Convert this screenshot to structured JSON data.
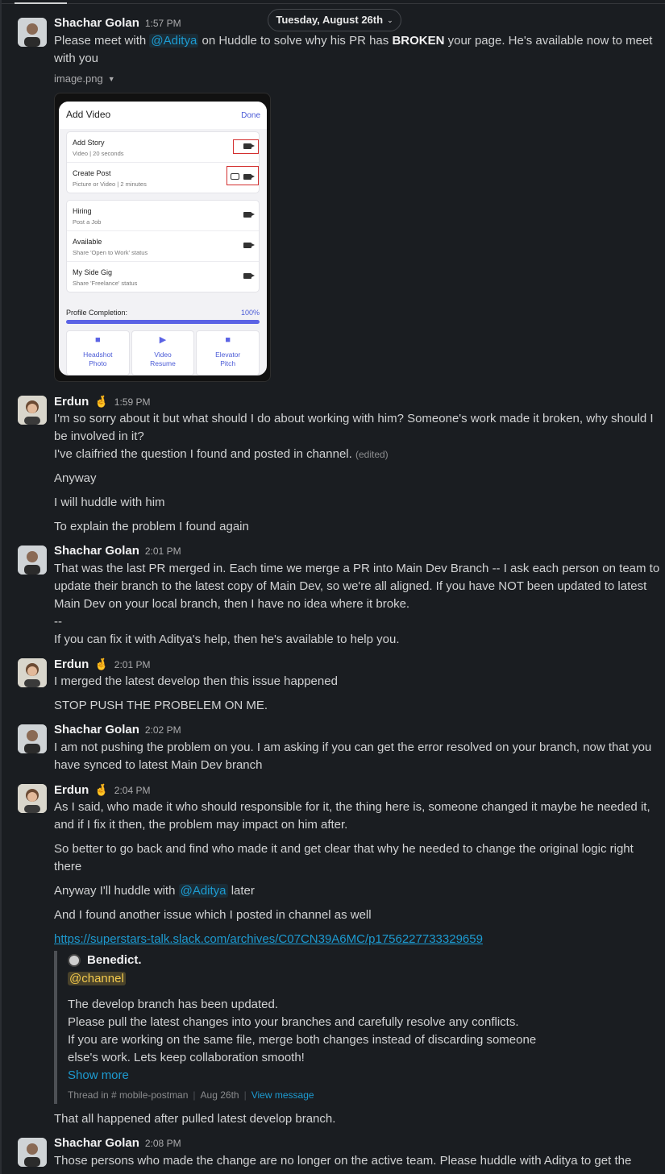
{
  "date_divider": "Tuesday, August 26th",
  "messages": {
    "m1": {
      "name": "Shachar Golan",
      "time": "1:57 PM",
      "l1a": "Please meet with ",
      "l1_mention": "@Aditya",
      "l1b": " on Huddle to solve why his PR has ",
      "l1_bold": "BROKEN",
      "l1c": " your page. He's available now to meet",
      "l2": "with you",
      "file_name": "image.png"
    },
    "m2": {
      "name": "Erdun",
      "emoji": "🤞",
      "time": "1:59 PM",
      "l1": "I'm so sorry about it but what should I do about working with him? Someone's work made it broken, why should I",
      "l2": "be involved in it?",
      "l3": "I've claifried the question I found and posted in channel.",
      "edited": "(edited)",
      "l4": "Anyway",
      "l5": "I will huddle with him",
      "l6": "To explain the problem I found again"
    },
    "m3": {
      "name": "Shachar Golan",
      "time": "2:01 PM",
      "l1": "That was the last PR merged in. Each time we merge a PR into Main Dev Branch -- I ask each person on team to",
      "l2": "update their branch to the latest copy of Main Dev, so we're all aligned. If you have NOT been updated to latest",
      "l3": "Main Dev on your local branch, then I have no idea where it broke.",
      "l4": "--",
      "l5": "If you can fix it with Aditya's help, then he's available to help you."
    },
    "m4": {
      "name": "Erdun",
      "emoji": "🤞",
      "time": "2:01 PM",
      "l1": "I merged the latest develop then this issue happened",
      "l2": "STOP PUSH THE PROBELEM ON ME."
    },
    "m5": {
      "name": "Shachar Golan",
      "time": "2:02 PM",
      "l1": "I am not pushing the problem on you. I am asking if you can get the error resolved on your branch, now that you",
      "l2": "have synced to latest Main Dev branch"
    },
    "m6": {
      "name": "Erdun",
      "emoji": "🤞",
      "time": "2:04 PM",
      "l1": "As I said, who made it who should responsible for it, the thing here is, someone changed it maybe he needed it,",
      "l2": "and if I fix it then, the problem may impact on him after.",
      "l3": "So better to go back and find who made it and get clear that why he needed to change the original logic right",
      "l4": "there",
      "l5a": "Anyway I'll huddle with ",
      "l5_mention": "@Aditya",
      "l5b": " later",
      "l6": "And I found another issue which I posted in channel as well",
      "link": "https://superstars-talk.slack.com/archives/C07CN39A6MC/p1756227733329659",
      "quote": {
        "name": "Benedict.",
        "channel": "@channel",
        "q1": "The develop branch has been updated.",
        "q2": "Please pull the latest changes into your branches and carefully resolve any conflicts.",
        "q3": "If you are working on the same file, merge both changes instead of discarding someone",
        "q4": "else's work. Lets keep collaboration smooth!",
        "show_more": "Show more",
        "foot_thread": "Thread in # mobile-postman",
        "foot_date": "Aug 26th",
        "foot_view": "View message"
      },
      "l7": "That all happened after pulled latest develop branch."
    },
    "m7": {
      "name": "Shachar Golan",
      "time": "2:08 PM",
      "l1": "Those persons who made the change are no longer on the active team. Please huddle with Aditya to get the"
    }
  },
  "phone_screen": {
    "title": "Add Video",
    "done": "Done",
    "group1": [
      {
        "title": "Add Story",
        "sub": "Video | 20 seconds"
      },
      {
        "title": "Create Post",
        "sub": "Picture or Video | 2 minutes"
      }
    ],
    "group2": [
      {
        "title": "Hiring",
        "sub": "Post a Job"
      },
      {
        "title": "Available",
        "sub": "Share 'Open to Work' status"
      },
      {
        "title": "My Side Gig",
        "sub": "Share 'Freelance' status"
      }
    ],
    "progress_label": "Profile Completion:",
    "progress_value": "100%",
    "tiles": [
      {
        "l1": "Headshot",
        "l2": "Photo",
        "icon": "■"
      },
      {
        "l1": "Video",
        "l2": "Resume",
        "icon": "▶"
      },
      {
        "l1": "Elevator",
        "l2": "Pitch",
        "icon": "■"
      }
    ]
  },
  "colors": {
    "background": "#1a1d21",
    "mention": "#1d9bd1",
    "channel_mention": "#f2c94c"
  }
}
